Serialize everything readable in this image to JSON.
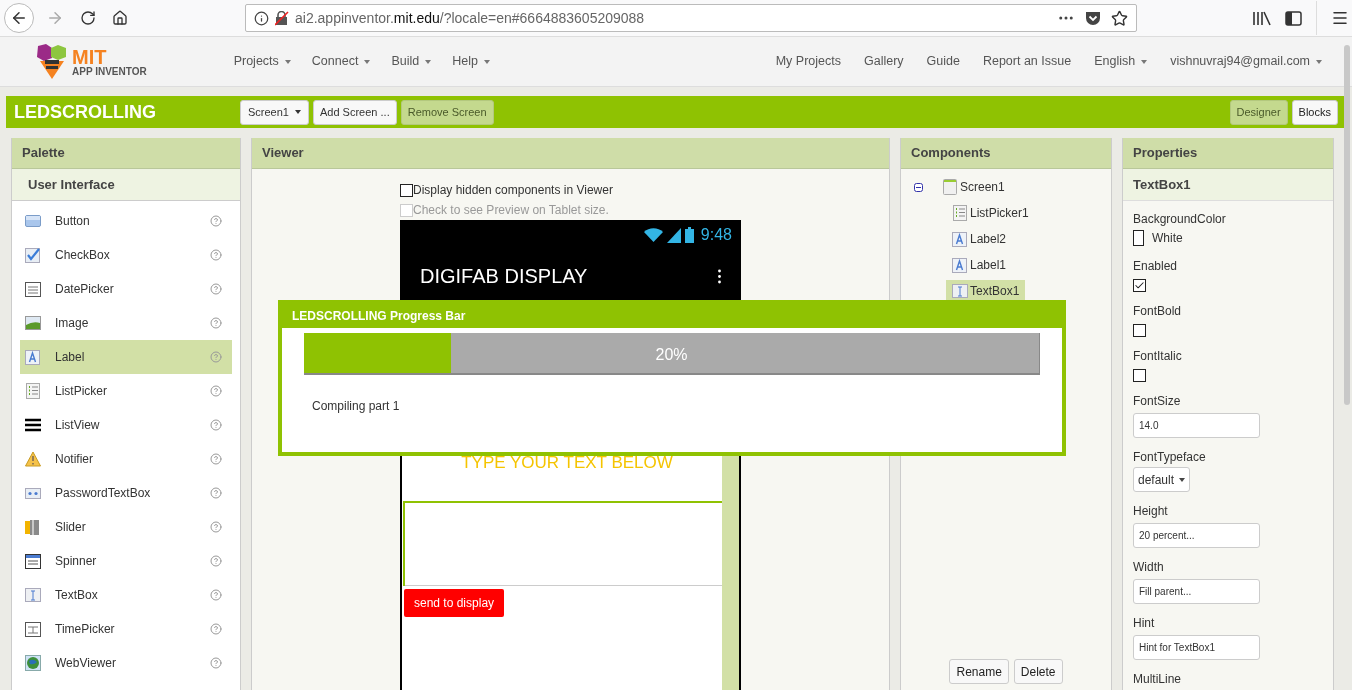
{
  "browser": {
    "url": "ai2.appinventor.**mit.edu**/?locale=en#6664883605209088"
  },
  "header": {
    "logo": {
      "title": "MIT",
      "subtitle": "APP INVENTOR"
    },
    "menus": [
      {
        "label": "Projects",
        "dropdown": true
      },
      {
        "label": "Connect",
        "dropdown": true
      },
      {
        "label": "Build",
        "dropdown": true
      },
      {
        "label": "Help",
        "dropdown": true
      }
    ],
    "links": [
      {
        "label": "My Projects",
        "dropdown": false
      },
      {
        "label": "Gallery",
        "dropdown": false
      },
      {
        "label": "Guide",
        "dropdown": false
      },
      {
        "label": "Report an Issue",
        "dropdown": false
      },
      {
        "label": "English",
        "dropdown": true
      },
      {
        "label": "vishnuvraj94@gmail.com",
        "dropdown": true
      }
    ]
  },
  "toolbar": {
    "project": "LEDSCROLLING",
    "screen": "Screen1",
    "screen_buttons": [
      {
        "label": "Add Screen ...",
        "disabled": false
      },
      {
        "label": "Remove Screen",
        "disabled": true
      }
    ],
    "views": [
      {
        "label": "Designer",
        "selected": true
      },
      {
        "label": "Blocks",
        "selected": false
      }
    ]
  },
  "palette": {
    "title": "Palette",
    "category": "User Interface",
    "items": [
      {
        "label": "Button",
        "kind": "button",
        "selected": false
      },
      {
        "label": "CheckBox",
        "kind": "checkbox",
        "selected": false
      },
      {
        "label": "DatePicker",
        "kind": "datepicker",
        "selected": false
      },
      {
        "label": "Image",
        "kind": "image",
        "selected": false
      },
      {
        "label": "Label",
        "kind": "label",
        "selected": true
      },
      {
        "label": "ListPicker",
        "kind": "listpicker",
        "selected": false
      },
      {
        "label": "ListView",
        "kind": "listview",
        "selected": false
      },
      {
        "label": "Notifier",
        "kind": "notifier",
        "selected": false
      },
      {
        "label": "PasswordTextBox",
        "kind": "password",
        "selected": false
      },
      {
        "label": "Slider",
        "kind": "slider",
        "selected": false
      },
      {
        "label": "Spinner",
        "kind": "spinner",
        "selected": false
      },
      {
        "label": "TextBox",
        "kind": "textbox",
        "selected": false
      },
      {
        "label": "TimePicker",
        "kind": "timepicker",
        "selected": false
      },
      {
        "label": "WebViewer",
        "kind": "webviewer",
        "selected": false
      }
    ]
  },
  "viewer": {
    "title": "Viewer",
    "options": [
      {
        "label": "Display hidden components in Viewer",
        "checked": false,
        "disabled": false
      },
      {
        "label": "Check to see Preview on Tablet size.",
        "checked": false,
        "disabled": true
      }
    ],
    "phone": {
      "time": "9:48",
      "title": "DIGIFAB DISPLAY",
      "heading": "TYPE YOUR TEXT BELOW",
      "button": "send to display"
    }
  },
  "components": {
    "title": "Components",
    "tree": [
      {
        "label": "Screen1",
        "kind": "screen",
        "selected": false,
        "expanded": true,
        "children": [
          {
            "label": "ListPicker1",
            "kind": "listpicker",
            "selected": false
          },
          {
            "label": "Label2",
            "kind": "label",
            "selected": false
          },
          {
            "label": "Label1",
            "kind": "label",
            "selected": false
          },
          {
            "label": "TextBox1",
            "kind": "textbox",
            "selected": true
          }
        ]
      }
    ],
    "buttons": [
      "Rename",
      "Delete"
    ]
  },
  "properties": {
    "title": "Properties",
    "component": "TextBox1",
    "items": [
      {
        "label": "BackgroundColor",
        "kind": "color",
        "value": "White"
      },
      {
        "label": "Enabled",
        "kind": "checkbox",
        "checked": true
      },
      {
        "label": "FontBold",
        "kind": "checkbox",
        "checked": false
      },
      {
        "label": "FontItalic",
        "kind": "checkbox",
        "checked": false
      },
      {
        "label": "FontSize",
        "kind": "text",
        "value": "14.0"
      },
      {
        "label": "FontTypeface",
        "kind": "select",
        "value": "default"
      },
      {
        "label": "Height",
        "kind": "text",
        "value": "20 percent..."
      },
      {
        "label": "Width",
        "kind": "text",
        "value": "Fill parent..."
      },
      {
        "label": "Hint",
        "kind": "text",
        "value": "Hint for TextBox1"
      },
      {
        "label": "MultiLine",
        "kind": "label"
      }
    ]
  },
  "dialog": {
    "title": "LEDSCROLLING Progress Bar",
    "level": 0.2,
    "reading": "20%",
    "message": "Compiling part 1"
  }
}
